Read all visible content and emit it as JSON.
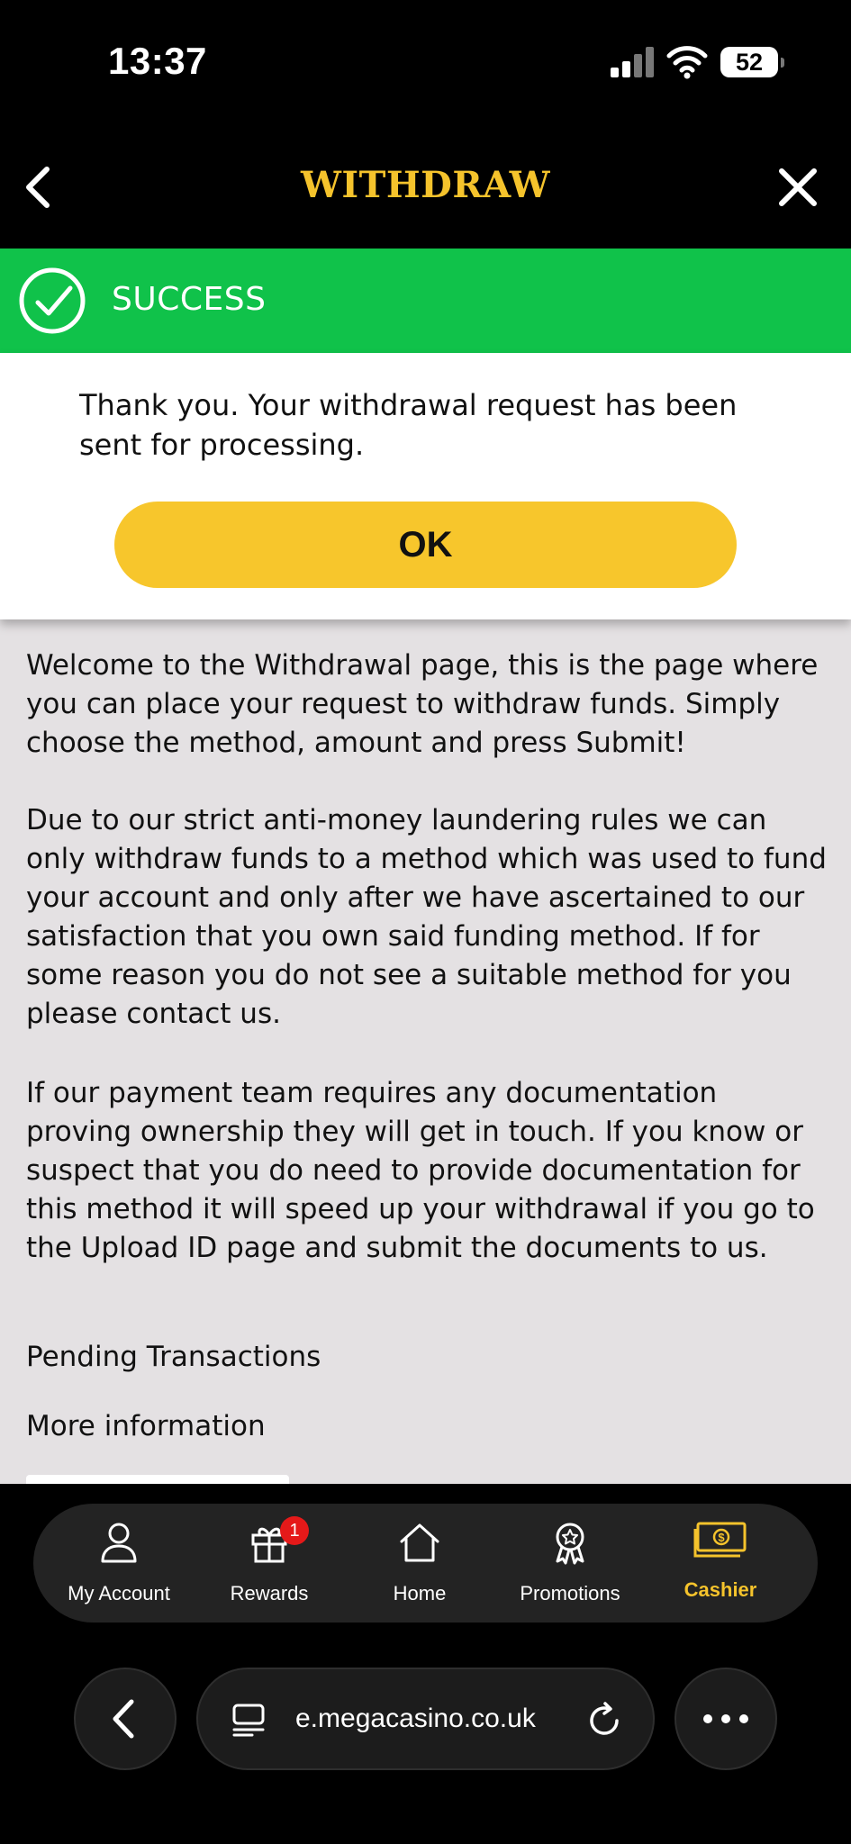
{
  "status_bar": {
    "time": "13:37",
    "battery": "52"
  },
  "header": {
    "title": "WITHDRAW"
  },
  "success": {
    "label": "SUCCESS"
  },
  "dialog": {
    "message": "Thank you. Your withdrawal request has been sent for processing.",
    "ok_label": "OK"
  },
  "content": {
    "paragraph_1": "Welcome to the Withdrawal page, this is the page where you can place your request to withdraw funds. Simply choose the method, amount and press Submit!",
    "paragraph_2": "Due to our strict anti-money laundering rules we can only withdraw funds to a method which was used to fund your account and only after we have ascertained to our satisfaction that you own said funding method. If for some reason you do not see a suitable method for you please contact us.",
    "paragraph_3": "If our payment team requires any documentation proving ownership they will get in touch. If you know or suspect that you do need to provide documentation for this method it will speed up your withdrawal if you go to the Upload ID page and submit the documents to us.",
    "pending_label": "Pending Transactions",
    "more_info_label": "More information"
  },
  "bottom_nav": {
    "items": [
      {
        "label": "My Account",
        "icon": "user-icon"
      },
      {
        "label": "Rewards",
        "icon": "gift-icon",
        "badge": "1"
      },
      {
        "label": "Home",
        "icon": "home-icon"
      },
      {
        "label": "Promotions",
        "icon": "award-icon"
      },
      {
        "label": "Cashier",
        "icon": "cash-icon",
        "active": true
      }
    ],
    "active_color": "#f5c32c"
  },
  "browser": {
    "url": "e.megacasino.co.uk"
  },
  "colors": {
    "accent": "#f5c32c",
    "success": "#10c24a",
    "button": "#f7c62c"
  }
}
